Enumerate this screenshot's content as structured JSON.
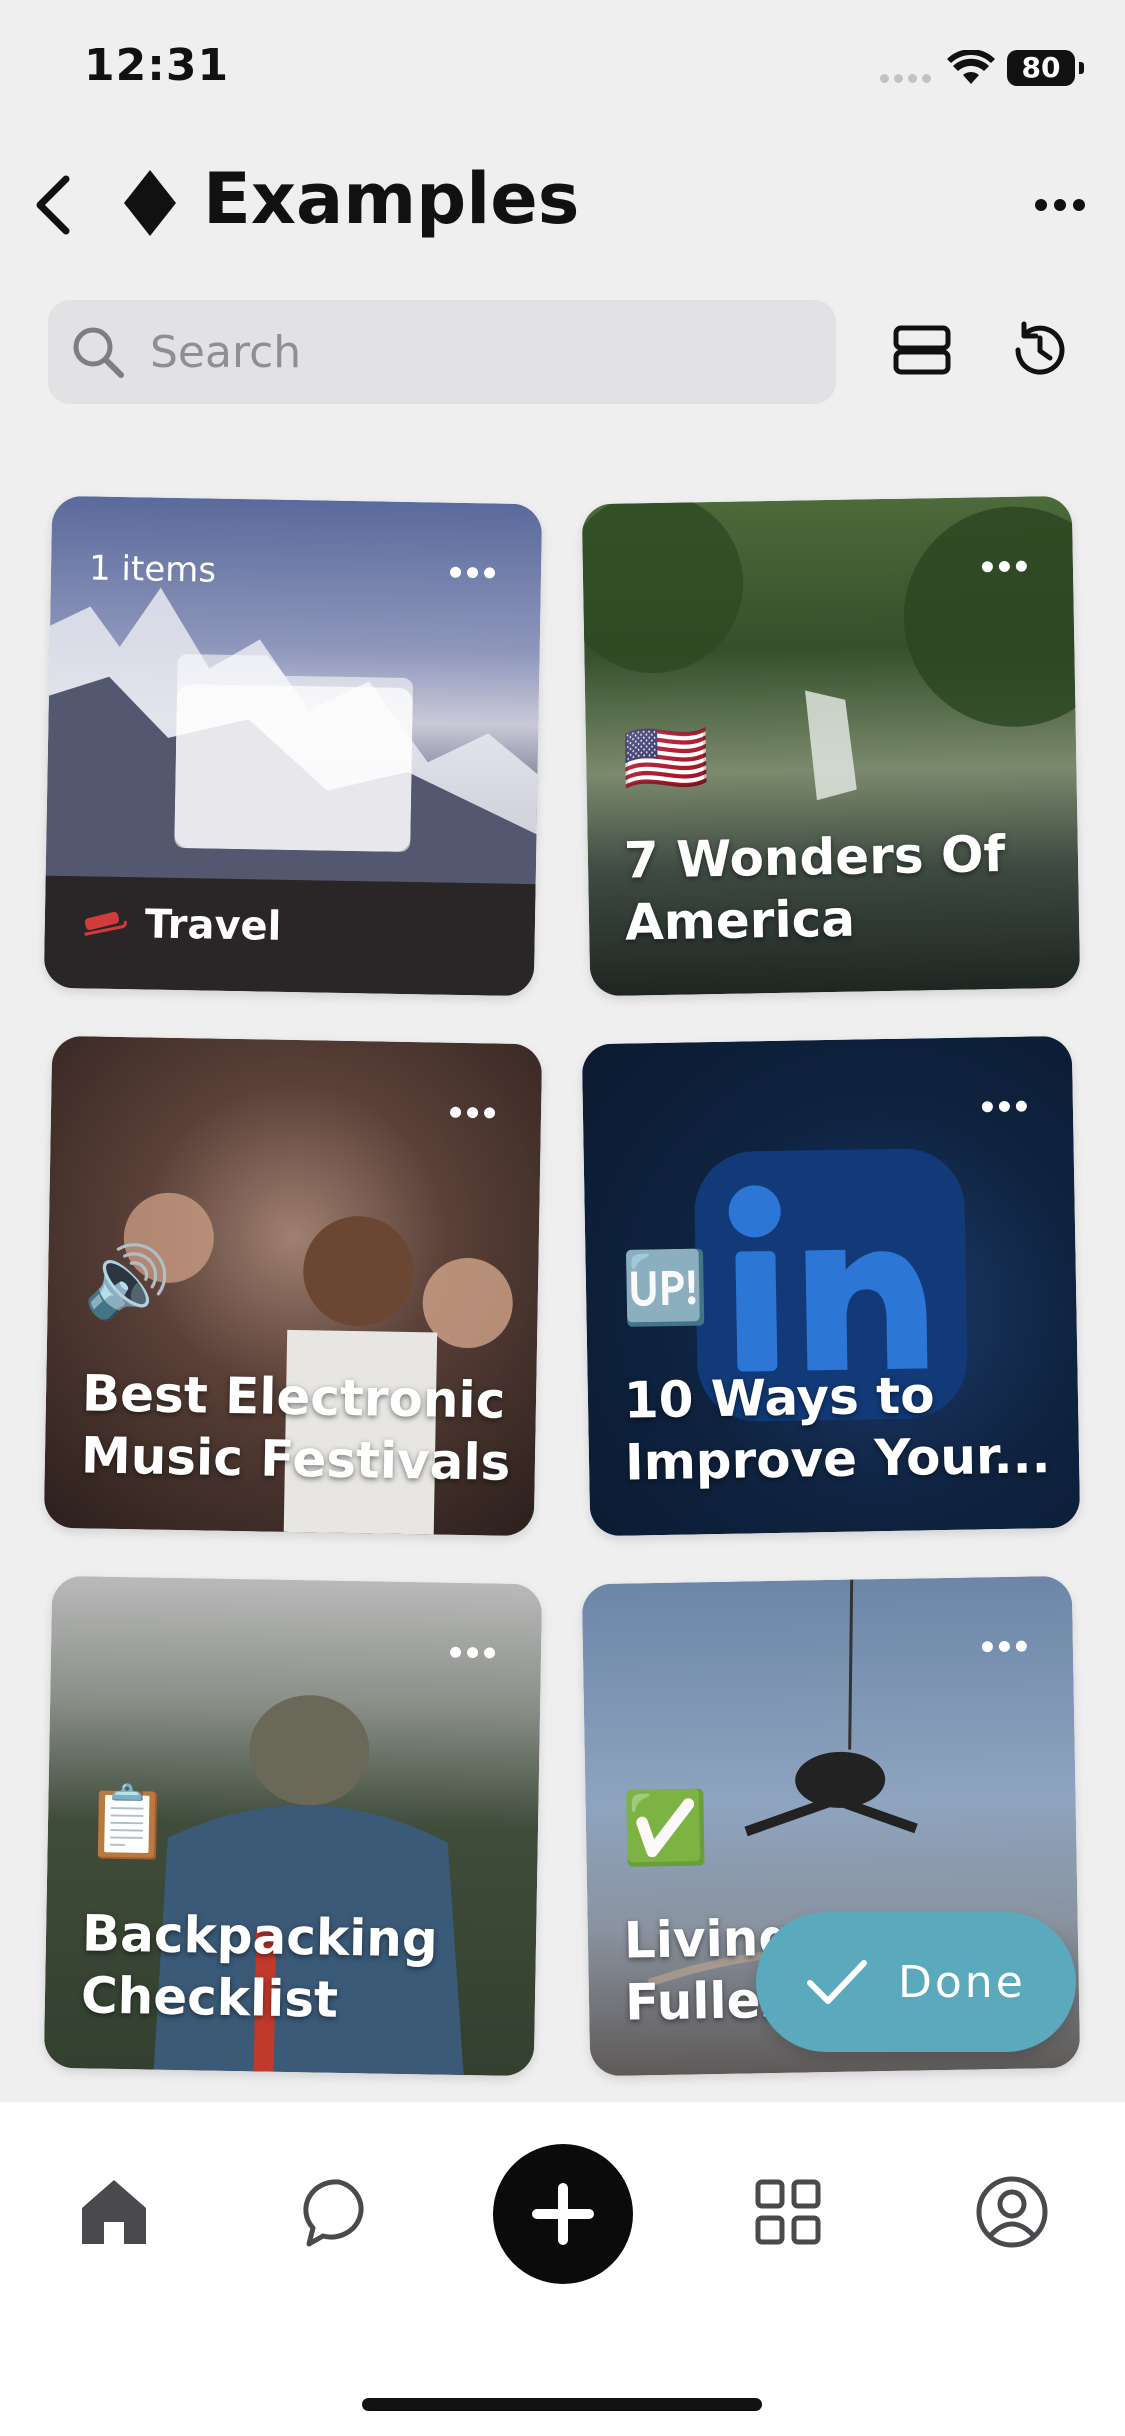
{
  "status_bar": {
    "time": "12:31",
    "battery": "80"
  },
  "header": {
    "title": "Examples",
    "title_icon": "diamond-icon",
    "back_icon": "chevron-left-icon",
    "more_icon": "ellipsis-icon"
  },
  "search": {
    "placeholder": "Search",
    "value": ""
  },
  "toolbar": {
    "view_icon": "list-view-icon",
    "history_icon": "history-icon"
  },
  "cards": [
    {
      "type": "folder",
      "count_label": "1 items",
      "name": "Travel",
      "badge_icon": "sled-icon"
    },
    {
      "type": "list",
      "emoji": "🇺🇸",
      "title": "7 Wonders Of\nAmerica"
    },
    {
      "type": "list",
      "emoji": "🔊",
      "title": "Best Electronic\nMusic Festivals"
    },
    {
      "type": "list",
      "emoji": "🆙",
      "title": "10 Ways to\nImprove Your..."
    },
    {
      "type": "list",
      "emoji": "📋",
      "title": "Backpacking\nChecklist"
    },
    {
      "type": "list",
      "emoji": "✅",
      "title": "Living\nFulles"
    }
  ],
  "done_button": {
    "label": "Done"
  },
  "tabbar": {
    "items": [
      {
        "icon": "home-icon"
      },
      {
        "icon": "chat-icon"
      },
      {
        "icon": "add-icon"
      },
      {
        "icon": "grid-icon"
      },
      {
        "icon": "profile-icon"
      }
    ]
  },
  "colors": {
    "accent": "#5aa9bc",
    "background": "#efeff0",
    "tabbar": "#ffffff"
  }
}
